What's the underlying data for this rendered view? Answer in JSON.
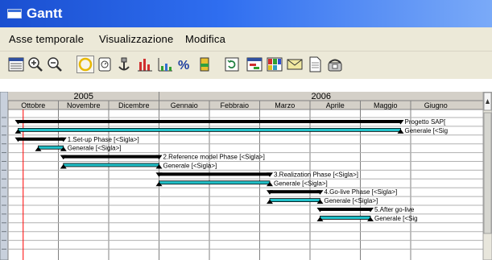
{
  "window": {
    "title": "Gantt"
  },
  "menu": {
    "items": [
      "Asse temporale",
      "Visualizzazione",
      "Modifica"
    ]
  },
  "toolbar": {
    "buttons": [
      "calendar-icon",
      "zoom-in-icon",
      "zoom-out-icon",
      "circle-icon",
      "clock-icon",
      "anchor-icon",
      "bar-chart-icon",
      "column-chart-icon",
      "percent-icon",
      "flask-icon",
      "refresh-icon",
      "timeline-icon",
      "grid-color-icon",
      "mail-icon",
      "document-icon",
      "phone-icon"
    ]
  },
  "timeline": {
    "years": [
      "2005",
      "2006"
    ],
    "months": [
      "Ottobre",
      "Novembre",
      "Dicembre",
      "Gennaio",
      "Febbraio",
      "Marzo",
      "Aprile",
      "Maggio",
      "Giugno"
    ]
  },
  "tasks": [
    {
      "label": "Progetto SAP[",
      "kind": "summary",
      "start": 0.2,
      "end": 7.8
    },
    {
      "label": "Generale [<Sig",
      "kind": "task",
      "start": 0.2,
      "end": 7.8
    },
    {
      "label": "1.Set-up Phase [<Sigla>]",
      "kind": "summary",
      "start": 0.2,
      "end": 1.1
    },
    {
      "label": "Generale [<Sigla>]",
      "kind": "task",
      "start": 0.6,
      "end": 1.1
    },
    {
      "label": "2.Reference model Phase [<Sigla>]",
      "kind": "summary",
      "start": 1.1,
      "end": 3.0
    },
    {
      "label": "Generale [<Sigla>]",
      "kind": "task",
      "start": 1.1,
      "end": 3.0
    },
    {
      "label": "3.Realization Phase [<Sigla>]",
      "kind": "summary",
      "start": 3.0,
      "end": 5.2
    },
    {
      "label": "Generale [<Sigla>]",
      "kind": "task",
      "start": 3.0,
      "end": 5.2
    },
    {
      "label": "4.Go-live Phase [<Sigla>]",
      "kind": "summary",
      "start": 5.2,
      "end": 6.2
    },
    {
      "label": "Generale [<Sigla>]",
      "kind": "task",
      "start": 5.2,
      "end": 6.2
    },
    {
      "label": "5.After go-live",
      "kind": "summary",
      "start": 6.2,
      "end": 7.2
    },
    {
      "label": "Generale [<Sig",
      "kind": "task",
      "start": 6.2,
      "end": 7.2
    }
  ],
  "today": 0.3,
  "colors": {
    "titlebar": "#2f6ef0",
    "task_bar": "#20c0c8",
    "summary_bar": "#000000",
    "today_line": "#ff0000",
    "header_bg": "#d4d0c8"
  }
}
